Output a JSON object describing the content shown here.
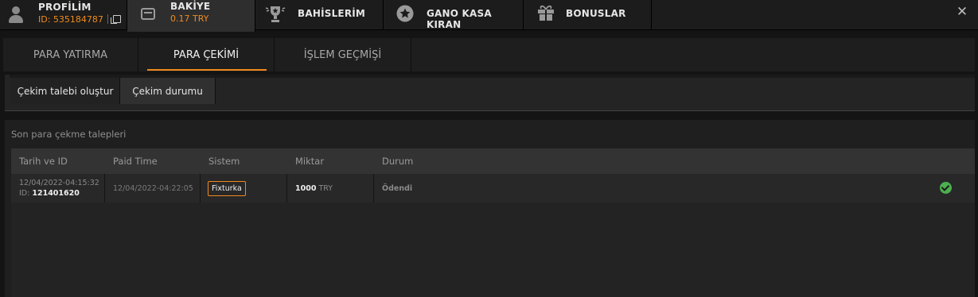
{
  "nav": {
    "profile": {
      "label": "PROFİLİM",
      "id_text": "ID: 535184787"
    },
    "balance": {
      "label": "BAKİYE",
      "amount": "0.17 TRY"
    },
    "bets": {
      "label": "BAHİSLERİM"
    },
    "gano": {
      "label": "GANO KASA KIRAN"
    },
    "bonus": {
      "label": "BONUSLAR"
    },
    "close": "✕"
  },
  "main_tabs": [
    "PARA YATIRMA",
    "PARA ÇEKİMİ",
    "İŞLEM GEÇMİŞİ"
  ],
  "active_main_tab": "PARA ÇEKİMİ",
  "sub_tabs": [
    "Çekim talebi oluştur",
    "Çekim durumu"
  ],
  "active_sub_tab": "Çekim durumu",
  "panel": {
    "title": "Son para çekme talepleri",
    "columns": [
      "Tarih ve ID",
      "Paid Time",
      "Sistem",
      "Miktar",
      "Durum"
    ],
    "rows": [
      {
        "date": "12/04/2022-04:15:32",
        "id_prefix": "ID:",
        "id": "121401620",
        "paid_time": "12/04/2022-04:22:05",
        "system": "Fixturka",
        "amount": "1000",
        "currency": "TRY",
        "status": "Ödendi",
        "status_icon": "check-circle-icon"
      }
    ]
  },
  "colors": {
    "accent": "#f08a1c",
    "success": "#4caf50",
    "background": "#141414"
  }
}
